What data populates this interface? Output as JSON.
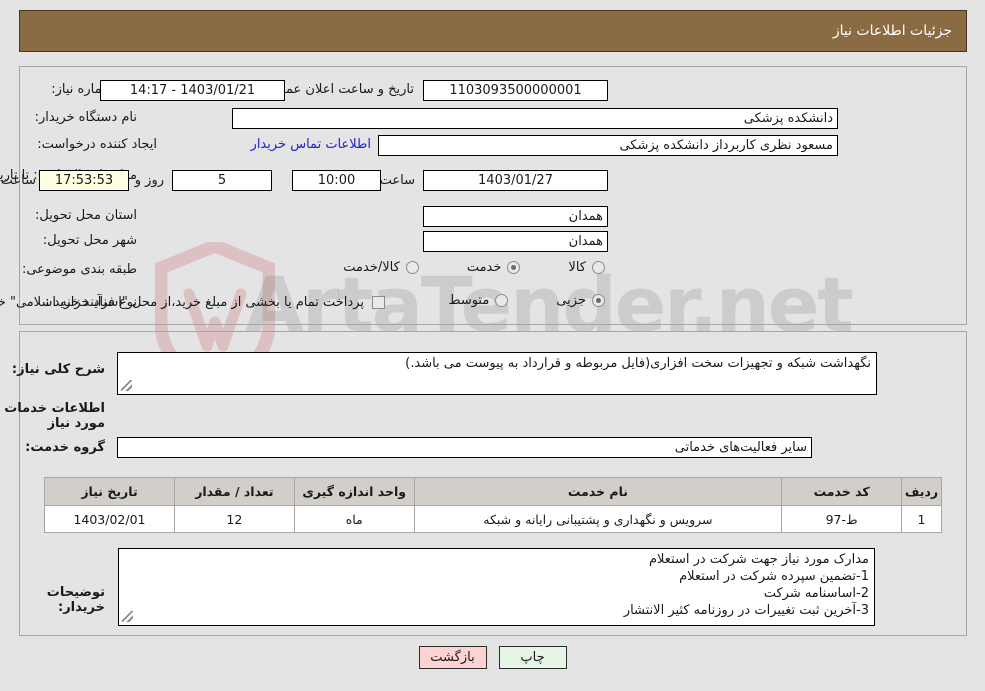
{
  "header": {
    "title": "جزئیات اطلاعات نیاز"
  },
  "top_form": {
    "need_number_label": "شماره نیاز:",
    "need_number_value": "1103093500000001",
    "announce_datetime_label": "تاریخ و ساعت اعلان عمومی:",
    "announce_datetime_value": "1403/01/21 - 14:17",
    "buyer_org_label": "نام دستگاه خریدار:",
    "buyer_org_value": "دانشکده پزشکی",
    "creator_label": "ایجاد کننده درخواست:",
    "creator_value": "مسعود نظری کاربرداز دانشکده پزشکی",
    "contact_link": "اطلاعات تماس خریدار",
    "deadline_label": "مهلت ارسال پاسخ: تا تاریخ:",
    "deadline_date": "1403/01/27",
    "hour_label": "ساعت",
    "deadline_time": "10:00",
    "days_remaining": "5",
    "days_label": "روز و",
    "time_remaining": "17:53:53",
    "remaining_suffix_label": "ساعت باقی مانده",
    "province_label": "استان محل تحویل:",
    "province_value": "همدان",
    "city_label": "شهر محل تحویل:",
    "city_value": "همدان",
    "category_label": "طبقه بندی موضوعی:",
    "category_options": [
      {
        "label": "کالا",
        "selected": false
      },
      {
        "label": "خدمت",
        "selected": true
      },
      {
        "label": "کالا/خدمت",
        "selected": false
      }
    ],
    "process_label": "نوع فرآیند خرید :",
    "process_options": [
      {
        "label": "جزیی",
        "selected": true
      },
      {
        "label": "متوسط",
        "selected": false
      }
    ],
    "treasury_checkbox_checked": false,
    "treasury_note": "پرداخت تمام یا بخشی از مبلغ خرید،از محل \"اسناد خزانه اسلامی\" خواهد بود."
  },
  "mid_form": {
    "general_desc_label": "شرح کلی نیاز:",
    "general_desc_value": "نگهداشت شبکه و تجهیزات سخت افزاری(فایل مربوطه و قرارداد به پیوست می باشد.)",
    "services_section_title": "اطلاعات خدمات مورد نیاز",
    "service_group_label": "گروه خدمت:",
    "service_group_value": "سایر فعالیت‌های خدماتی",
    "buyer_notes_label": "توضیحات خریدار:",
    "buyer_notes_value": "مدارک مورد نیاز جهت شرکت در استعلام\n1-تضمین سپرده شرکت در استعلام\n2-اساسنامه شرکت\n3-آخرین ثبت تغییرات در روزنامه کثیر الانتشار"
  },
  "table": {
    "headers": [
      "ردیف",
      "کد خدمت",
      "نام خدمت",
      "واحد اندازه گیری",
      "تعداد / مقدار",
      "تاریخ نیاز"
    ],
    "rows": [
      {
        "index": "1",
        "code": "ط-97",
        "name": "سرویس و نگهداری و پشتیبانی رایانه و شبکه",
        "unit": "ماه",
        "quantity": "12",
        "need_date": "1403/02/01"
      }
    ]
  },
  "buttons": {
    "print": "چاپ",
    "back": "بازگشت"
  },
  "watermark": {
    "text": "ArtaTender.net"
  },
  "colors": {
    "header_bg": "#8b6b43",
    "accent_link": "#2222cc",
    "print_btn": "#e6f5e6",
    "back_btn": "#fcd2d2",
    "cream_field": "#ffffe4",
    "table_header": "#d2cfcb"
  }
}
